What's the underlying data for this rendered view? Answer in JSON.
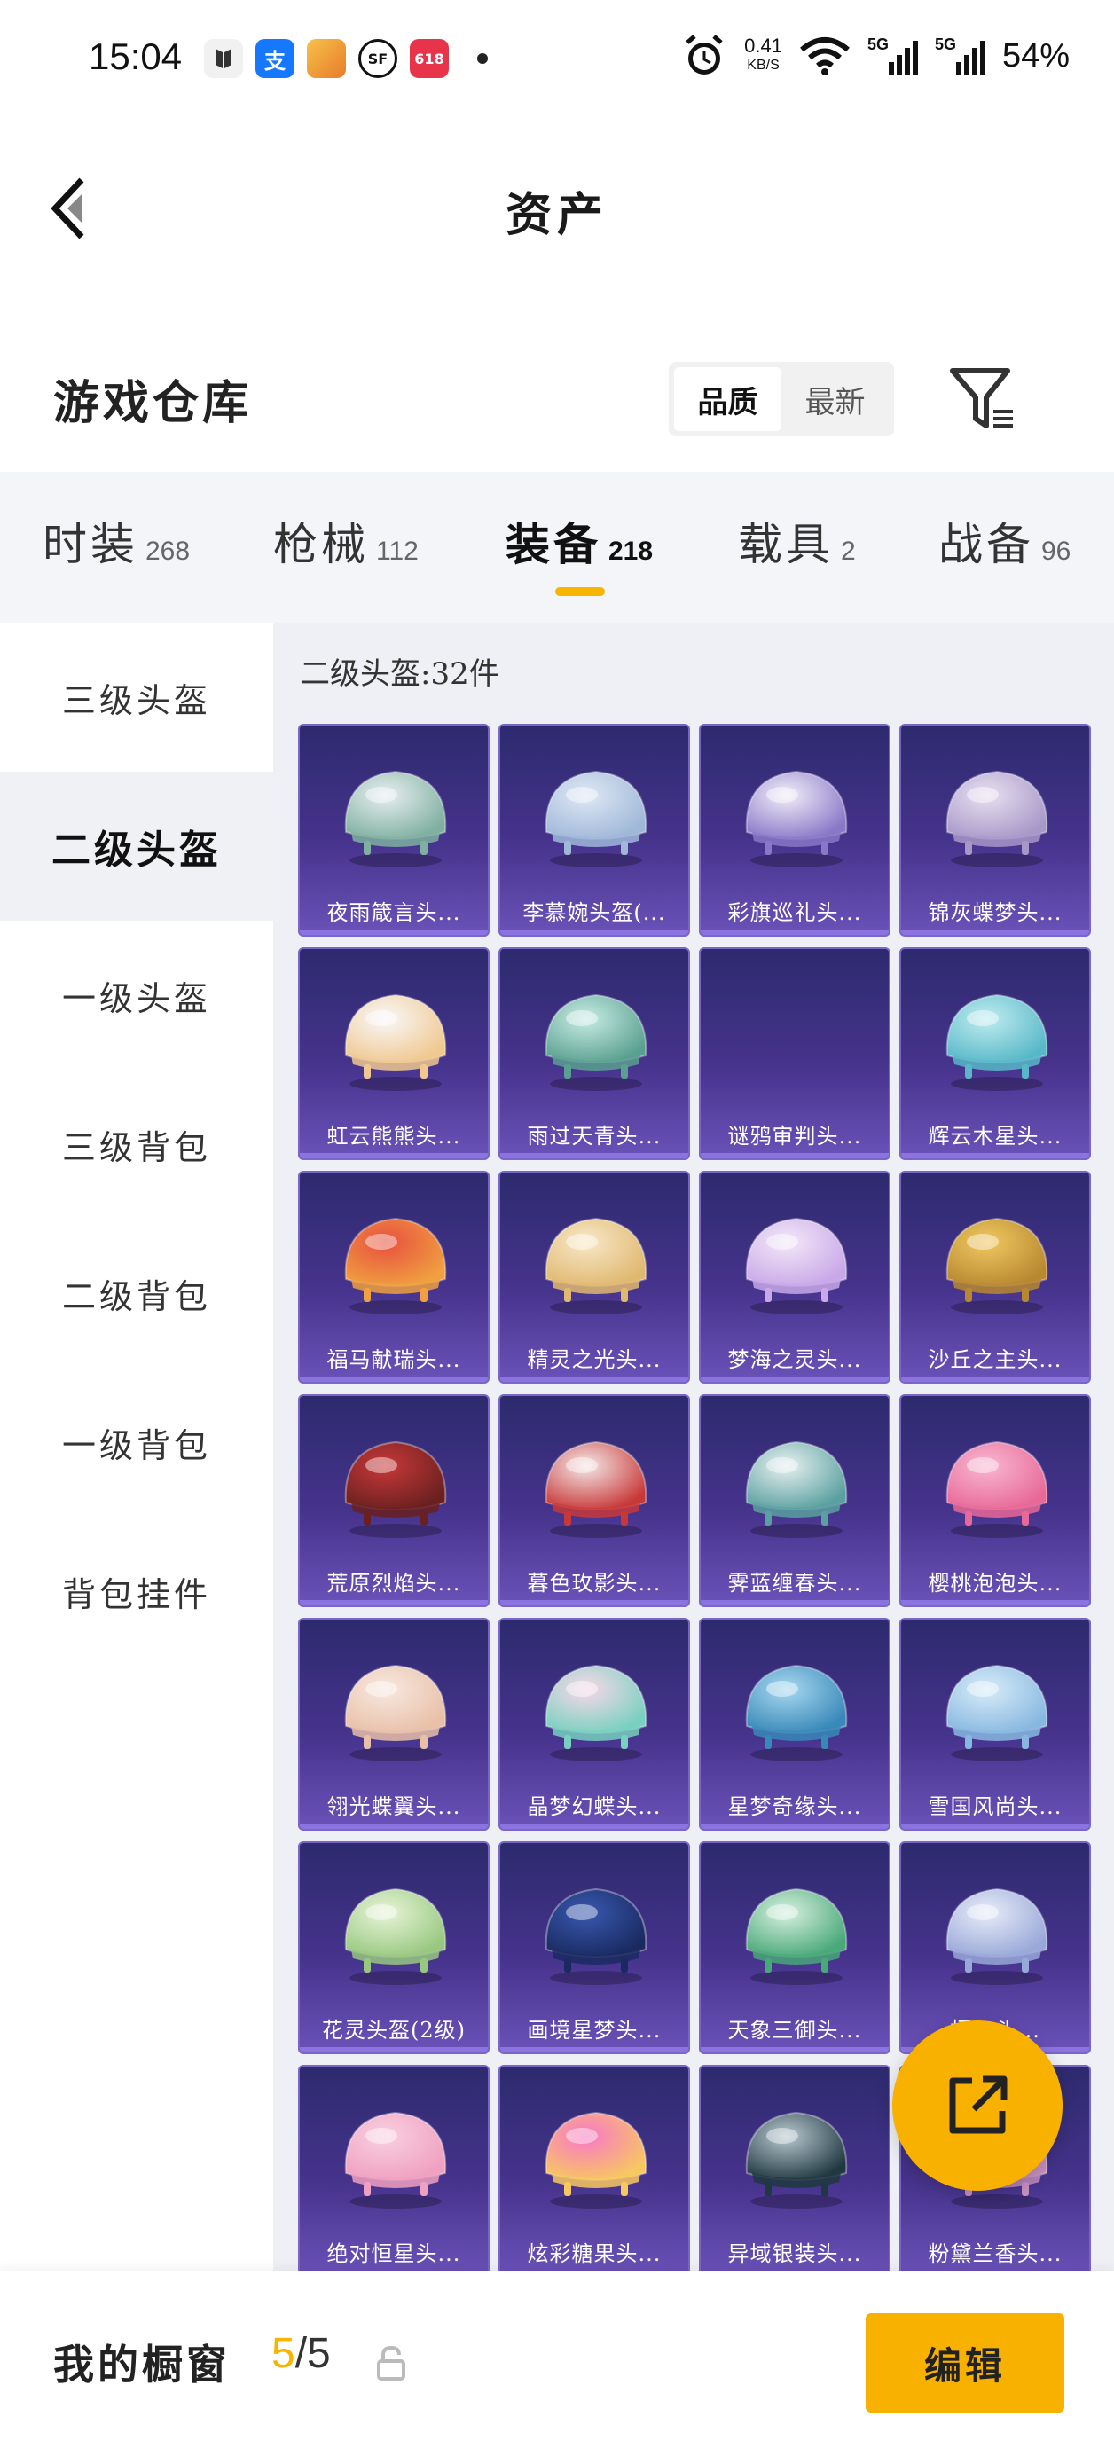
{
  "status_bar": {
    "time": "15:04",
    "speed_value": "0.41",
    "speed_unit": "KB/S",
    "battery": "54%",
    "app_icons": [
      "baidu-icon",
      "alipay-icon",
      "app-icon",
      "sf-icon",
      "jd-618-icon"
    ],
    "alipay_char": "支",
    "sf_char": "SF",
    "jd_char": "618",
    "net_5g_1": "5G",
    "net_5g_2": "5G"
  },
  "header": {
    "title": "资产"
  },
  "warehouse": {
    "title": "游戏仓库",
    "sort_options": [
      "品质",
      "最新"
    ],
    "active_sort": "品质"
  },
  "categories": [
    {
      "name": "时装",
      "count": "268"
    },
    {
      "name": "枪械",
      "count": "112"
    },
    {
      "name": "装备",
      "count": "218"
    },
    {
      "name": "载具",
      "count": "2"
    },
    {
      "name": "战备",
      "count": "96"
    }
  ],
  "active_category": "装备",
  "sidebar": {
    "items": [
      "三级头盔",
      "二级头盔",
      "一级头盔",
      "三级背包",
      "二级背包",
      "一级背包",
      "背包挂件"
    ],
    "active": "二级头盔"
  },
  "grid": {
    "count_label": "二级头盔:32件",
    "items": [
      {
        "name": "夜雨箴言头...",
        "c1": "#e8eef0",
        "c2": "#7fb0a0"
      },
      {
        "name": "李慕婉头盔(...",
        "c1": "#dfe8f5",
        "c2": "#9fb8d8"
      },
      {
        "name": "彩旗巡礼头...",
        "c1": "#f2eef8",
        "c2": "#8878c8"
      },
      {
        "name": "锦灰蝶梦头...",
        "c1": "#e8e0f0",
        "c2": "#a898c8"
      },
      {
        "name": "虹云熊熊头...",
        "c1": "#f8f8fa",
        "c2": "#f0c890"
      },
      {
        "name": "雨过天青头...",
        "c1": "#c8ece4",
        "c2": "#5aa090"
      },
      {
        "name": "谜鸦审判头...",
        "c1": "",
        "c2": ""
      },
      {
        "name": "辉云木星头...",
        "c1": "#c0ecf0",
        "c2": "#58b8c8"
      },
      {
        "name": "福马献瑞头...",
        "c1": "#e85040",
        "c2": "#f0a040"
      },
      {
        "name": "精灵之光头...",
        "c1": "#f8e8c8",
        "c2": "#e0b870"
      },
      {
        "name": "梦海之灵头...",
        "c1": "#f4e8f8",
        "c2": "#c8a8e8"
      },
      {
        "name": "沙丘之主头...",
        "c1": "#f0c860",
        "c2": "#b88830"
      },
      {
        "name": "荒原烈焰头...",
        "c1": "#c83838",
        "c2": "#6a2020"
      },
      {
        "name": "暮色玫影头...",
        "c1": "#f4e8e8",
        "c2": "#c83838"
      },
      {
        "name": "霁蓝缠春头...",
        "c1": "#e8f0f0",
        "c2": "#5aa0a0"
      },
      {
        "name": "樱桃泡泡头...",
        "c1": "#f8b8d0",
        "c2": "#e86898"
      },
      {
        "name": "翎光蝶翼头...",
        "c1": "#f8e8e0",
        "c2": "#e8c0a8"
      },
      {
        "name": "晶梦幻蝶头...",
        "c1": "#f8d8e8",
        "c2": "#78d0c0"
      },
      {
        "name": "星梦奇缘头...",
        "c1": "#a8d8f0",
        "c2": "#3888b8"
      },
      {
        "name": "雪国风尚头...",
        "c1": "#d8ecf8",
        "c2": "#88b8e0"
      },
      {
        "name": "花灵头盔(2级)",
        "c1": "#e8f4d8",
        "c2": "#98c880"
      },
      {
        "name": "画境星梦头...",
        "c1": "#3858b0",
        "c2": "#1a2a60"
      },
      {
        "name": "天象三御头...",
        "c1": "#d8f0e0",
        "c2": "#48a878"
      },
      {
        "name": "柯...头...",
        "c1": "#e8ecf8",
        "c2": "#98a8d8"
      },
      {
        "name": "绝对恒星头...",
        "c1": "#f8d0e0",
        "c2": "#f0a0c0"
      },
      {
        "name": "炫彩糖果头...",
        "c1": "#f878c8",
        "c2": "#f8c860"
      },
      {
        "name": "异域银装头...",
        "c1": "#b8c8d0",
        "c2": "#203840"
      },
      {
        "name": "粉黛兰香头...",
        "c1": "#f0d8e8",
        "c2": "#c890c0"
      }
    ]
  },
  "bottom_bar": {
    "label": "我的橱窗",
    "current": "5",
    "separator": "/",
    "max": "5",
    "edit_label": "编辑"
  },
  "colors": {
    "accent": "#f9b100",
    "tab_bg": "#f4f5f9",
    "card_top": "#2d2a6e",
    "card_bottom": "#6a52b8"
  }
}
